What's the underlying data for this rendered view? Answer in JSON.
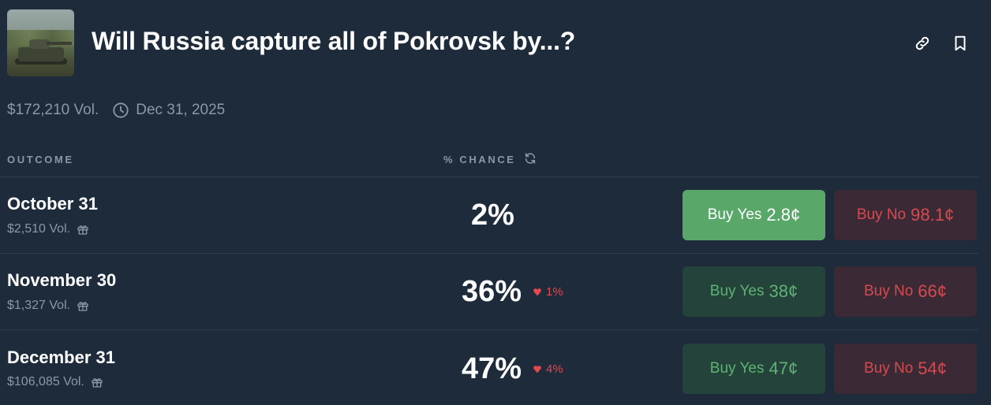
{
  "market": {
    "title": "Will Russia capture all of Pokrovsk by...?",
    "volume": "$172,210 Vol.",
    "end_date": "Dec 31, 2025",
    "thumbnail_icon": "tank-photo"
  },
  "header_icons": {
    "link": "link-icon",
    "bookmark": "bookmark-icon"
  },
  "table": {
    "outcome_header": "OUTCOME",
    "chance_header": "% CHANCE",
    "rows": [
      {
        "name": "October 31",
        "volume": "$2,510 Vol.",
        "chance": "2%",
        "delta": "",
        "yes_label": "Buy Yes",
        "yes_price": "2.8¢",
        "no_label": "Buy No",
        "no_price": "98.1¢"
      },
      {
        "name": "November 30",
        "volume": "$1,327 Vol.",
        "chance": "36%",
        "delta": "1%",
        "yes_label": "Buy Yes",
        "yes_price": "38¢",
        "no_label": "Buy No",
        "no_price": "66¢"
      },
      {
        "name": "December 31",
        "volume": "$106,085 Vol.",
        "chance": "47%",
        "delta": "4%",
        "yes_label": "Buy Yes",
        "yes_price": "47¢",
        "no_label": "Buy No",
        "no_price": "54¢"
      }
    ]
  },
  "colors": {
    "background": "#1d2b3a",
    "yes_active": "#59a86a",
    "yes_text": "#5fb273",
    "no_text": "#d64a4f",
    "delta_down": "#e5484d",
    "muted": "#8b98a7"
  }
}
